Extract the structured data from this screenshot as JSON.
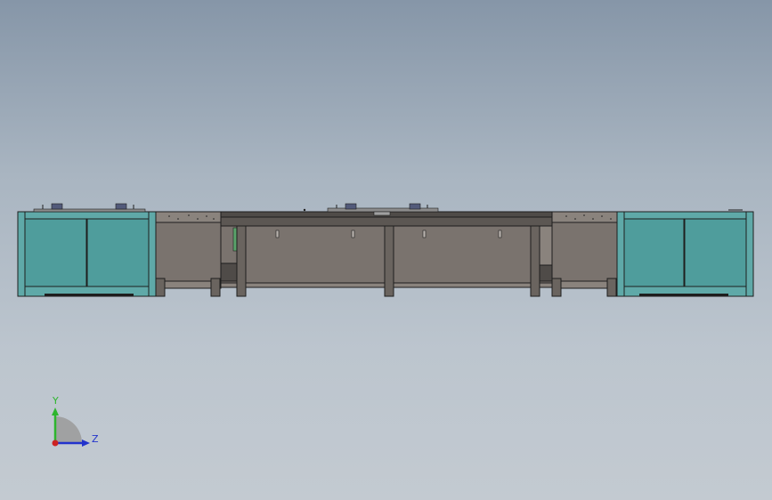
{
  "viewport": {
    "background_top": "#8696a8",
    "background_bottom": "#c3cad1"
  },
  "model": {
    "cabinet_color": "#4f9d9c",
    "frame_color": "#7a736e",
    "frame_dark": "#4f4b48",
    "outline_color": "#1e1e1e",
    "left_cabinet": {
      "door_panels": 2
    },
    "right_cabinet": {
      "door_panels": 2
    },
    "center_frame": {
      "leg_pairs": 3
    }
  },
  "triad": {
    "y_label": "Y",
    "z_label": "Z",
    "y_color": "#2db52d",
    "z_color": "#2233cc",
    "x_color": "#cc2222"
  }
}
